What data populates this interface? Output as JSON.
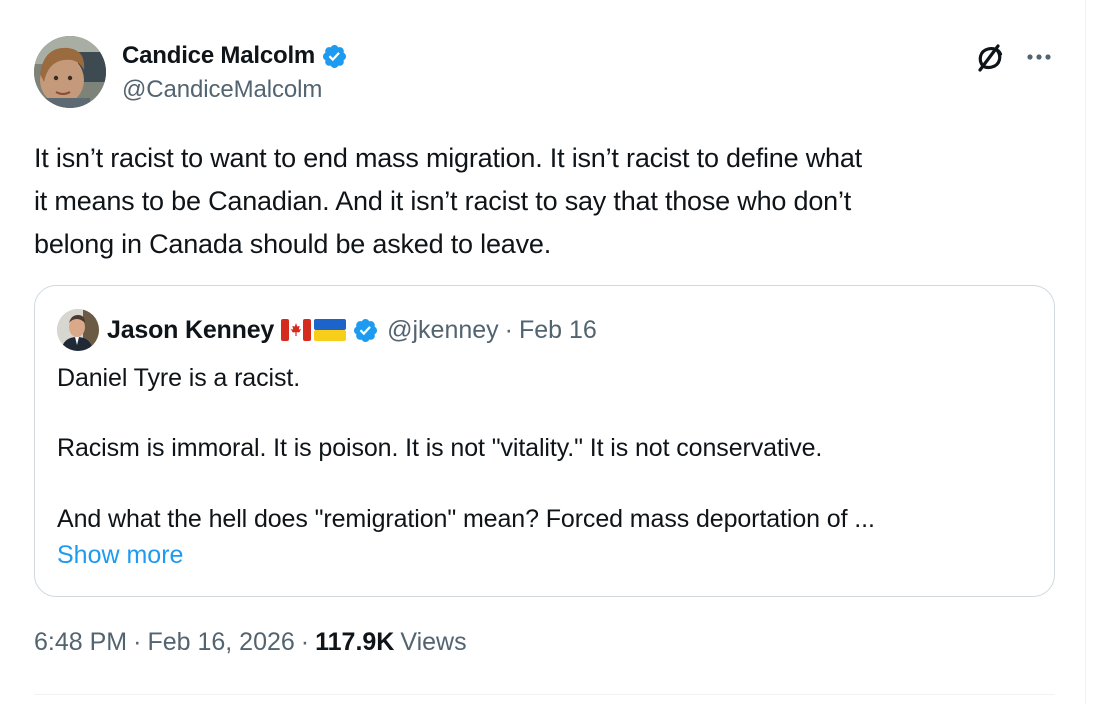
{
  "author": {
    "display_name": "Candice Malcolm",
    "handle": "@CandiceMalcolm",
    "verified": true
  },
  "tweet": {
    "text_lines": [
      "It isn’t racist to want to end mass migration. It isn’t racist to define what",
      "it means to be Canadian. And it isn’t racist to say that those who don’t",
      "belong in Canada should be asked to leave."
    ]
  },
  "quote": {
    "display_name": "Jason Kenney",
    "flags": [
      "canada-flag",
      "ukraine-flag"
    ],
    "handle": "@jkenney",
    "separator": "·",
    "date": "Feb 16",
    "lines": [
      "Daniel Tyre is a racist.",
      "Racism is immoral. It is poison. It is not \"vitality.\" It is not conservative.",
      "And what the hell does \"remigration\" mean? Forced mass deportation of ..."
    ],
    "show_more": "Show more"
  },
  "meta": {
    "time": "6:48 PM",
    "sep1": "·",
    "date": "Feb 16, 2026",
    "sep2": "·",
    "views_count": "117.9K",
    "views_label": "Views"
  },
  "icons": {
    "grok": "grok-icon",
    "more": "more-icon",
    "verified": "verified-badge-icon"
  },
  "colors": {
    "text": "#0f1419",
    "secondary": "#536471",
    "link": "#1d9bf0",
    "border": "#cfd9de"
  }
}
